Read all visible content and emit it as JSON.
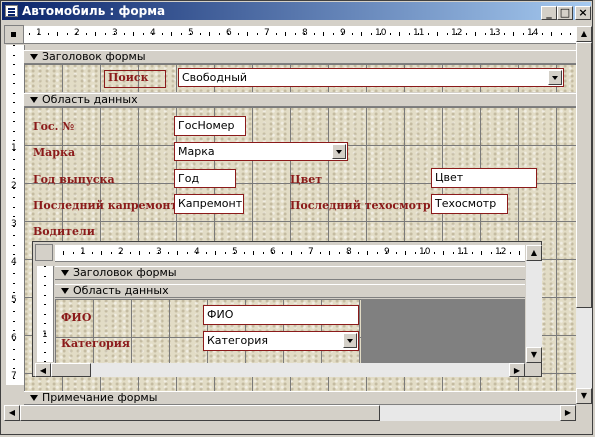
{
  "window": {
    "title": "Автомобиль : форма"
  },
  "ruler": {
    "h_numbers": [
      "1",
      "2",
      "3",
      "4",
      "5",
      "6",
      "7",
      "8",
      "9",
      "10",
      "11",
      "12",
      "13",
      "14"
    ],
    "v_numbers": [
      "1",
      "2",
      "3",
      "4",
      "5",
      "6",
      "7"
    ]
  },
  "sections": {
    "header": "Заголовок формы",
    "detail": "Область данных",
    "footer": "Примечание формы"
  },
  "header_form": {
    "search_label": "Поиск",
    "search_value": "Свободный"
  },
  "fields": {
    "gos_label": "Гос. №",
    "gos_value": "ГосНомер",
    "marka_label": "Марка",
    "marka_value": "Марка",
    "year_label": "Год выпуска",
    "year_value": "Год",
    "color_label": "Цвет",
    "color_value": "Цвет",
    "repair_label": "Последний капремонт",
    "repair_value": "Капремонт",
    "inspect_label": "Последний техосмотр",
    "inspect_value": "Техосмотр",
    "drivers_label": "Водители"
  },
  "subform": {
    "ruler_numbers": [
      "1",
      "2",
      "3",
      "4",
      "5",
      "6",
      "7",
      "8",
      "9",
      "10",
      "11",
      "12"
    ],
    "vruler_numbers": [
      "1"
    ],
    "header": "Заголовок формы",
    "detail": "Область данных",
    "fio_label": "ФИО",
    "fio_value": "ФИО",
    "cat_label": "Категория",
    "cat_value": "Категория"
  },
  "colors": {
    "title_bar": "#0a246a",
    "label_text": "#8b1a1a",
    "texture": "#e2dcc6"
  }
}
